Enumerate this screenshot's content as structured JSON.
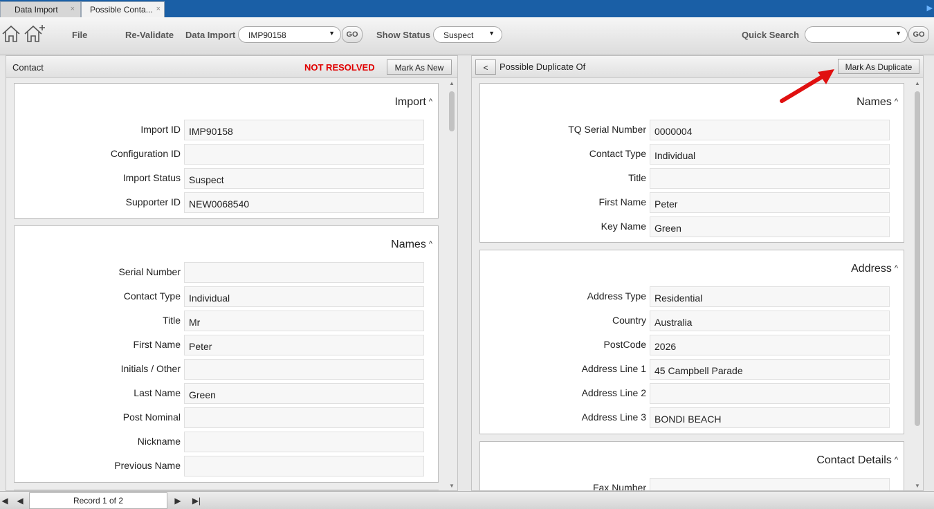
{
  "tabs": [
    {
      "label": "Data Import",
      "close": "×"
    },
    {
      "label": "Possible Conta...",
      "close": "×"
    }
  ],
  "tab_overflow_glyph": "▶",
  "toolbar": {
    "file_label": "File",
    "revalidate_label": "Re-Validate",
    "data_import_label": "Data Import",
    "data_import_value": "IMP90158",
    "go_label": "GO",
    "show_status_label": "Show Status",
    "show_status_value": "Suspect",
    "quick_search_label": "Quick Search",
    "quick_search_value": "",
    "quick_go_label": "GO"
  },
  "left_panel": {
    "title": "Contact",
    "status": "NOT RESOLVED",
    "mark_new_label": "Mark As New",
    "import_section": {
      "title": "Import",
      "fields": [
        {
          "label": "Import ID",
          "value": "IMP90158"
        },
        {
          "label": "Configuration ID",
          "value": ""
        },
        {
          "label": "Import Status",
          "value": "Suspect"
        },
        {
          "label": "Supporter ID",
          "value": "NEW0068540"
        }
      ]
    },
    "names_section": {
      "title": "Names",
      "fields": [
        {
          "label": "Serial Number",
          "value": ""
        },
        {
          "label": "Contact Type",
          "value": "Individual"
        },
        {
          "label": "Title",
          "value": "Mr"
        },
        {
          "label": "First Name",
          "value": "Peter"
        },
        {
          "label": "Initials / Other",
          "value": ""
        },
        {
          "label": "Last Name",
          "value": "Green"
        },
        {
          "label": "Post Nominal",
          "value": ""
        },
        {
          "label": "Nickname",
          "value": ""
        },
        {
          "label": "Previous Name",
          "value": ""
        }
      ]
    }
  },
  "right_panel": {
    "back_label": "<",
    "title": "Possible Duplicate Of",
    "mark_duplicate_label": "Mark As Duplicate",
    "names_section": {
      "title": "Names",
      "fields": [
        {
          "label": "TQ Serial Number",
          "value": "0000004"
        },
        {
          "label": "Contact Type",
          "value": "Individual"
        },
        {
          "label": "Title",
          "value": ""
        },
        {
          "label": "First Name",
          "value": "Peter"
        },
        {
          "label": "Key Name",
          "value": "Green"
        }
      ]
    },
    "address_section": {
      "title": "Address",
      "fields": [
        {
          "label": "Address Type",
          "value": "Residential"
        },
        {
          "label": "Country",
          "value": "Australia"
        },
        {
          "label": "PostCode",
          "value": "2026"
        },
        {
          "label": "Address Line 1",
          "value": "45 Campbell Parade"
        },
        {
          "label": "Address Line 2",
          "value": ""
        },
        {
          "label": "Address Line 3",
          "value": "BONDI BEACH"
        }
      ]
    },
    "contact_section": {
      "title": "Contact Details",
      "fields": [
        {
          "label": "Fax Number",
          "value": ""
        }
      ]
    }
  },
  "statusbar": {
    "record_text": "Record 1 of 2"
  },
  "colors": {
    "tab_strip": "#1a5fa6",
    "status_red": "#e00000",
    "annotation_arrow": "#e01010"
  }
}
